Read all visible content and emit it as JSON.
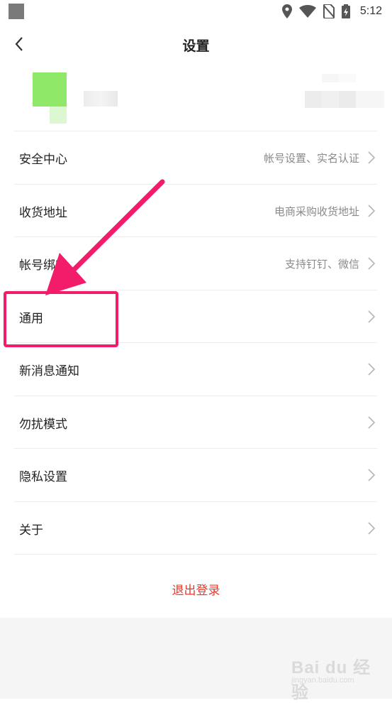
{
  "status_bar": {
    "time": "5:12",
    "icons": [
      "app-icon",
      "location-icon",
      "wifi-icon",
      "no-sim-icon",
      "battery-charging-icon"
    ]
  },
  "header": {
    "title": "设置",
    "back_icon": "chevron-left-icon"
  },
  "profile": {
    "avatar": "pixelated-avatar",
    "name": "",
    "account_id": ""
  },
  "menu": [
    {
      "label": "安全中心",
      "sub": "帐号设置、实名认证"
    },
    {
      "label": "收货地址",
      "sub": "电商采购收货地址"
    },
    {
      "label": "帐号绑定",
      "sub": "支持钉钉、微信"
    },
    {
      "label": "通用",
      "sub": ""
    },
    {
      "label": "新消息通知",
      "sub": ""
    },
    {
      "label": "勿扰模式",
      "sub": ""
    },
    {
      "label": "隐私设置",
      "sub": ""
    },
    {
      "label": "关于",
      "sub": ""
    }
  ],
  "logout": {
    "label": "退出登录"
  },
  "annotation": {
    "highlight_target": "通用",
    "color": "#f21c6b"
  },
  "watermark": {
    "brand": "Bai du 经验",
    "url": "jingyan.baidu.com"
  },
  "colors": {
    "accent_red": "#e8392c",
    "annotation_pink": "#f21c6b",
    "avatar_green": "#8fe868"
  }
}
